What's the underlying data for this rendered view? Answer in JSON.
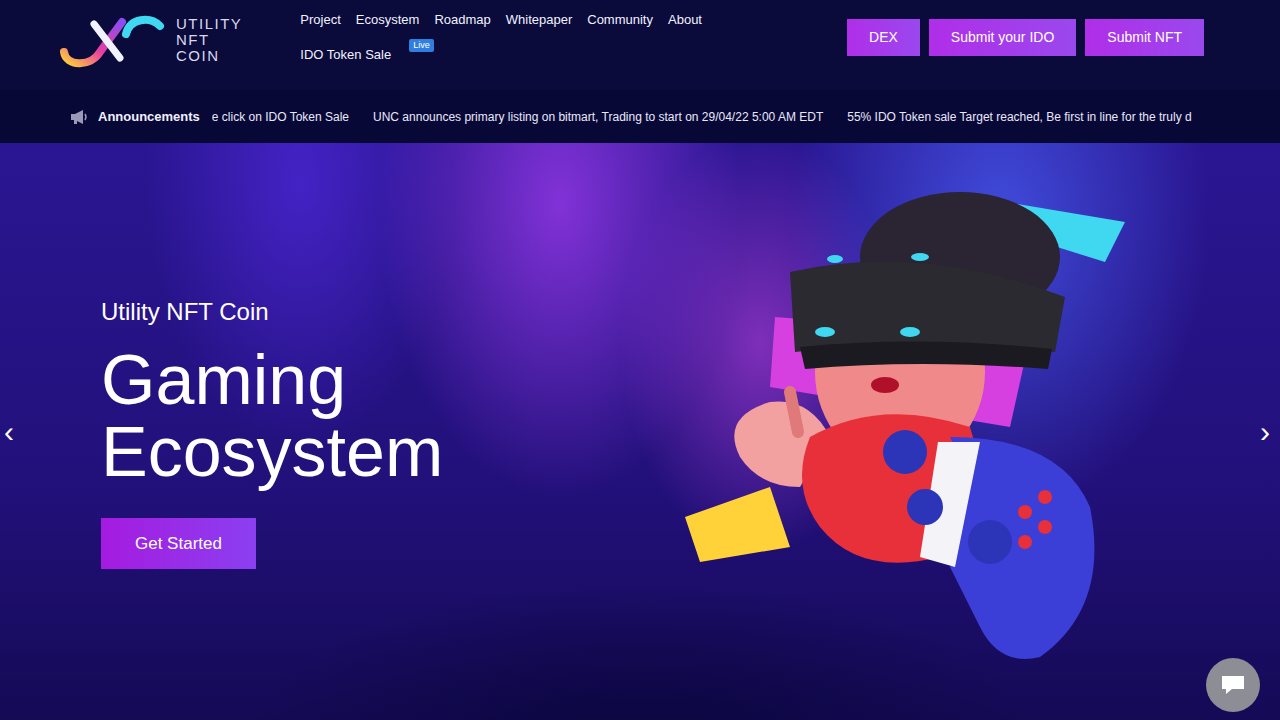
{
  "logo": {
    "lines": [
      "UTILITY",
      "NFT",
      "COIN"
    ]
  },
  "nav": {
    "items": [
      {
        "label": "Project"
      },
      {
        "label": "Ecosystem"
      },
      {
        "label": "Roadmap"
      },
      {
        "label": "Whitepaper"
      },
      {
        "label": "Community"
      },
      {
        "label": "About"
      }
    ],
    "sale": {
      "label": "IDO Token Sale",
      "badge": "Live"
    }
  },
  "actions": [
    {
      "label": "DEX"
    },
    {
      "label": "Submit your IDO"
    },
    {
      "label": "Submit NFT"
    }
  ],
  "announcements": {
    "title": "Announcements",
    "items": [
      "e click on IDO Token Sale",
      "UNC announces primary listing on bitmart, Trading to start on 29/04/22 5:00 AM EDT",
      "55% IDO Token sale Target reached, Be first in line for the truly d"
    ]
  },
  "hero": {
    "eyebrow": "Utility NFT Coin",
    "title": [
      "Gaming",
      "Ecosystem"
    ],
    "button": "Get Started"
  },
  "carousel": {
    "prev": "‹",
    "next": "›"
  }
}
